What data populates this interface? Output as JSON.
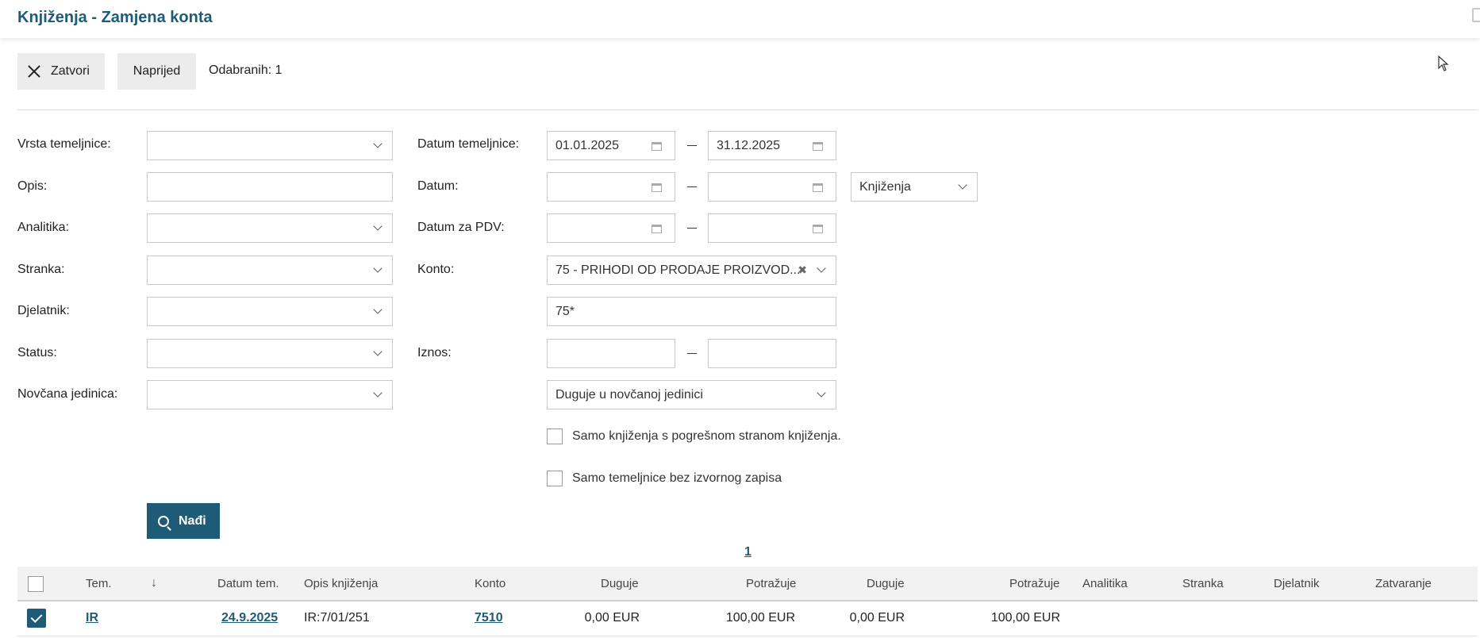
{
  "header": {
    "title": "Knjiženja - Zamjena konta"
  },
  "toolbar": {
    "close_label": "Zatvori",
    "next_label": "Naprijed",
    "selected_text": "Odabranih: 1"
  },
  "filters": {
    "left": {
      "vrsta_label": "Vrsta temeljnice:",
      "opis_label": "Opis:",
      "analitika_label": "Analitika:",
      "stranka_label": "Stranka:",
      "djelatnik_label": "Djelatnik:",
      "status_label": "Status:",
      "valuta_label": "Novčana jedinica:"
    },
    "right": {
      "datum_tem_label": "Datum temeljnice:",
      "datum_tem_from": "01.01.2025",
      "datum_tem_to": "31.12.2025",
      "datum_label": "Datum:",
      "datum_type": "Knjiženja",
      "datum_pdv_label": "Datum za PDV:",
      "konto_label": "Konto:",
      "konto_value": "75 - PRIHODI OD PRODAJE PROIZVOD...",
      "konto_pattern": "75*",
      "iznos_label": "Iznos:",
      "iznos_type": "Duguje u novčanoj jedinici",
      "check1_label": "Samo knjiženja s pogrešnom stranom knjiženja.",
      "check2_label": "Samo temeljnice bez izvornog zapisa"
    },
    "find_label": "Nađi"
  },
  "pagination": {
    "current": "1"
  },
  "table": {
    "headers": [
      "Tem.",
      "Datum tem.",
      "Opis knjiženja",
      "Konto",
      "Duguje",
      "Potražuje",
      "Duguje",
      "Potražuje",
      "Analitika",
      "Stranka",
      "Djelatnik",
      "Zatvaranje"
    ],
    "sort_icon": "↓",
    "rows": [
      {
        "tem": "IR",
        "datum": "24.9.2025",
        "opis": "IR:7/01/251",
        "konto": "7510",
        "duguje": "0,00 EUR",
        "potrazuje": "100,00 EUR",
        "duguje2": "0,00 EUR",
        "potrazuje2": "100,00 EUR"
      }
    ]
  }
}
